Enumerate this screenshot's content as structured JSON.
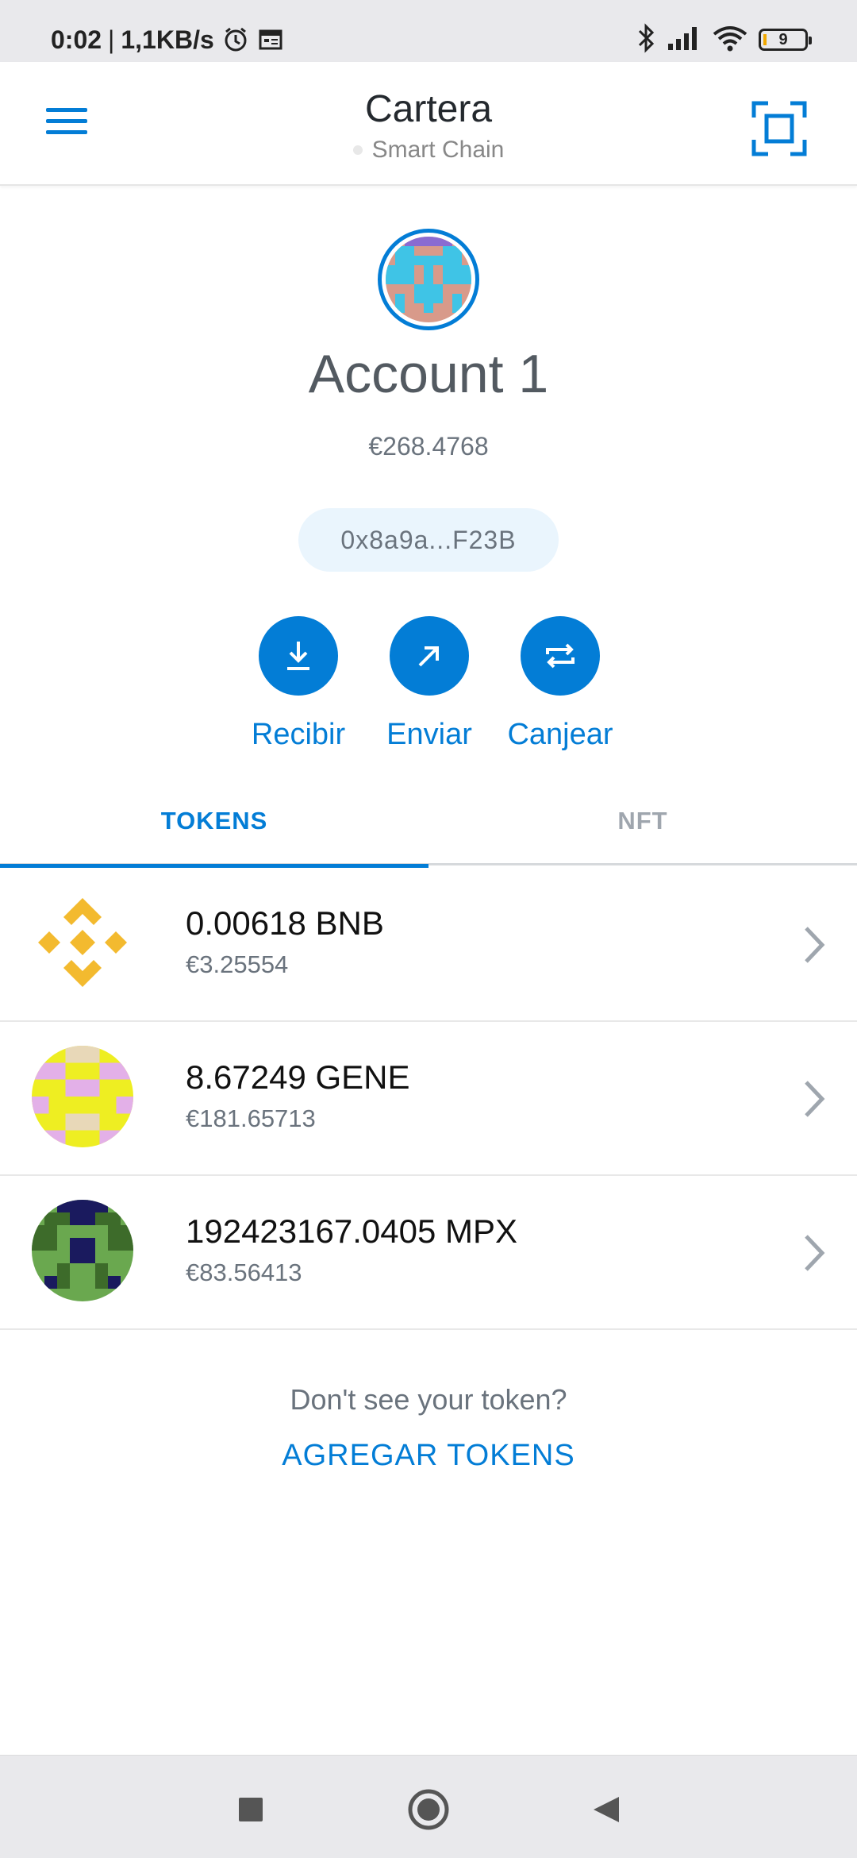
{
  "status_bar": {
    "time": "0:02",
    "network_speed": "1,1KB/s",
    "battery_level": "9",
    "icons": [
      "alarm-icon",
      "calendar-icon",
      "bluetooth-icon",
      "signal-icon",
      "wifi-icon",
      "battery-icon"
    ]
  },
  "header": {
    "title": "Cartera",
    "network": "Smart Chain",
    "menu_icon": "hamburger-menu-icon",
    "scan_icon": "scan-qr-icon"
  },
  "account": {
    "name": "Account 1",
    "balance": "€268.4768",
    "address": "0x8a9a...F23B"
  },
  "actions": [
    {
      "label": "Recibir",
      "icon": "receive-icon"
    },
    {
      "label": "Enviar",
      "icon": "send-icon"
    },
    {
      "label": "Canjear",
      "icon": "swap-icon"
    }
  ],
  "tabs": [
    {
      "label": "TOKENS",
      "active": true
    },
    {
      "label": "NFT",
      "active": false
    }
  ],
  "tokens": [
    {
      "amount": "0.00618 BNB",
      "fiat": "€3.25554",
      "icon": "bnb-logo-icon"
    },
    {
      "amount": "8.67249 GENE",
      "fiat": "€181.65713",
      "icon": "gene-token-icon"
    },
    {
      "amount": "192423167.0405 MPX",
      "fiat": "€83.56413",
      "icon": "mpx-token-icon"
    }
  ],
  "footer": {
    "dont_see": "Don't see your token?",
    "add_tokens": "AGREGAR TOKENS"
  },
  "nav_bar": {
    "icons": [
      "recents-square-icon",
      "home-circle-icon",
      "back-triangle-icon"
    ]
  },
  "colors": {
    "accent": "#037dd6",
    "bnb_yellow": "#f3ba2f",
    "text_primary": "#24292e",
    "text_secondary": "#6a737d"
  }
}
